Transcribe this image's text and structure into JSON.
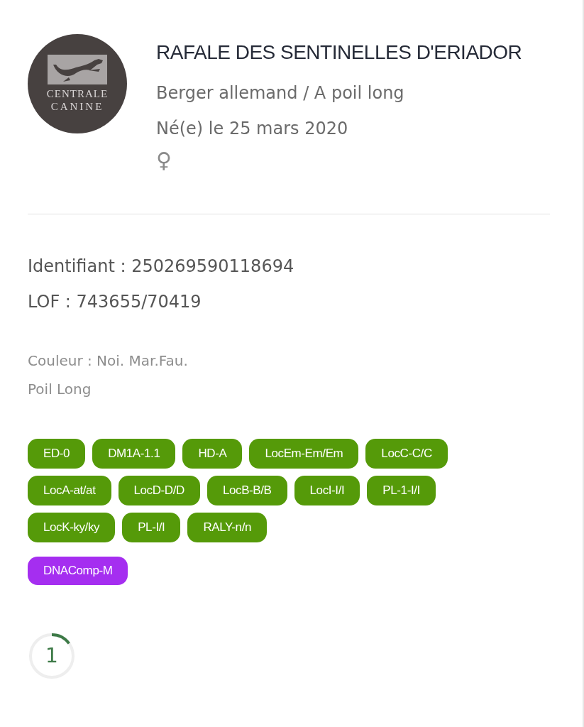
{
  "logo": {
    "line_1": "CENTRALE",
    "line_2": "CANINE"
  },
  "dog": {
    "name": "RAFALE DES SENTINELLES D'ERIADOR",
    "breed": "Berger allemand / A poil long",
    "birth": "Né(e) le 25 mars 2020",
    "sex_symbol": "♀"
  },
  "identifiers": [
    "Identifiant : 250269590118694",
    "LOF : 743655/70419"
  ],
  "details": [
    "Couleur : Noi. Mar.Fau.",
    "Poil Long"
  ],
  "tags": [
    {
      "label": "ED-0",
      "color": "#559a09"
    },
    {
      "label": "DM1A-1.1",
      "color": "#559a09"
    },
    {
      "label": "HD-A",
      "color": "#559a09"
    },
    {
      "label": "LocEm-Em/Em",
      "color": "#559a09"
    },
    {
      "label": "LocC-C/C",
      "color": "#559a09"
    },
    {
      "label": "LocA-at/at",
      "color": "#559a09"
    },
    {
      "label": "LocD-D/D",
      "color": "#559a09"
    },
    {
      "label": "LocB-B/B",
      "color": "#559a09"
    },
    {
      "label": "LocI-I/I",
      "color": "#559a09"
    },
    {
      "label": "PL-1-I/I",
      "color": "#559a09"
    },
    {
      "label": "LocK-ky/ky",
      "color": "#559a09"
    },
    {
      "label": "PL-I/I",
      "color": "#559a09"
    },
    {
      "label": "RALY-n/n",
      "color": "#559a09"
    },
    {
      "label": "DNAComp-M",
      "color": "#a52ef0"
    }
  ],
  "progress": {
    "label": "1",
    "level": 0.15
  }
}
